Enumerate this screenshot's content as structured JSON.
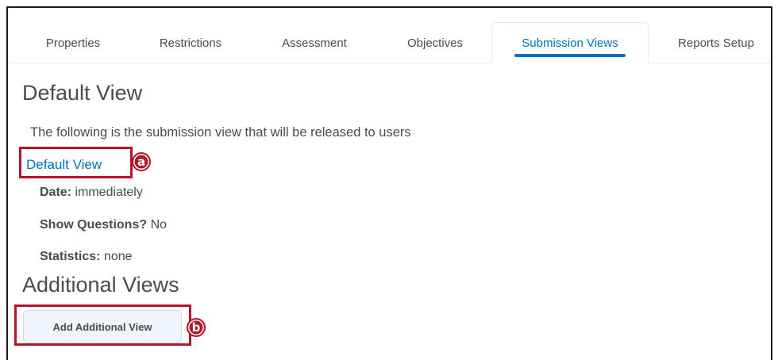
{
  "tabs": [
    {
      "label": "Properties"
    },
    {
      "label": "Restrictions"
    },
    {
      "label": "Assessment"
    },
    {
      "label": "Objectives"
    },
    {
      "label": "Submission Views"
    },
    {
      "label": "Reports Setup"
    }
  ],
  "active_tab": "Submission Views",
  "default_view": {
    "heading": "Default View",
    "description": "The following is the submission view that will be released to users",
    "link_label": "Default View",
    "date_label": "Date:",
    "date_value": "immediately",
    "questions_label": "Show Questions?",
    "questions_value": "No",
    "statistics_label": "Statistics:",
    "statistics_value": "none"
  },
  "additional_views": {
    "heading": "Additional Views",
    "add_button_label": "Add Additional View"
  },
  "callouts": {
    "a": "a",
    "b": "b"
  },
  "colors": {
    "accent": "#006fbf",
    "callout": "#b0182a",
    "text": "#494c4e"
  }
}
